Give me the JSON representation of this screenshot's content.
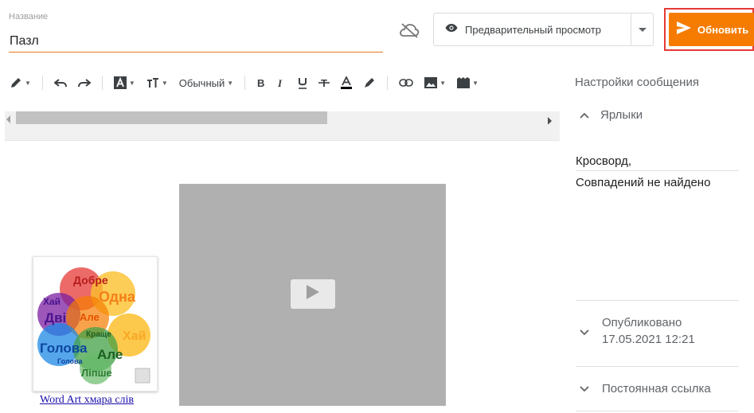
{
  "header": {
    "title_label": "Название",
    "title_value": "Пазл",
    "preview_label": "Предварительный просмотр",
    "update_label": "Обновить"
  },
  "toolbar": {
    "paragraph_style": "Обычный"
  },
  "editor": {
    "wordart_caption": "Word Art хмара слів",
    "wordart_words": [
      "Добре",
      "Хай",
      "Одна",
      "Дві",
      "Але",
      "Голова",
      "Краще",
      "Хай",
      "Але",
      "Лiпше",
      "Голова"
    ]
  },
  "sidebar": {
    "settings_title": "Настройки сообщения",
    "labels_section": "Ярлыки",
    "labels_value": "Кросворд,",
    "no_match_text": "Совпадений не найдено",
    "published_label": "Опубликовано",
    "published_date": "17.05.2021 12:21",
    "permalink_label": "Постоянная ссылка"
  },
  "colors": {
    "accent_orange": "#f57c00",
    "highlight_red": "#e53935",
    "title_underline": "#e8761f"
  }
}
